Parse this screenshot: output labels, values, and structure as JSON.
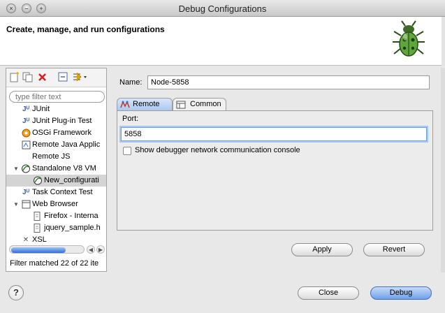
{
  "window": {
    "title": "Debug Configurations"
  },
  "header": {
    "heading": "Create, manage, and run configurations"
  },
  "left": {
    "filter_placeholder": "type filter text",
    "tree": [
      {
        "label": "JUnit",
        "icon": "junit-icon",
        "level": 1
      },
      {
        "label": "JUnit Plug-in Test",
        "icon": "junit-plugin-icon",
        "level": 1
      },
      {
        "label": "OSGi Framework",
        "icon": "osgi-icon",
        "level": 1
      },
      {
        "label": "Remote Java Applic",
        "icon": "remote-java-icon",
        "level": 1
      },
      {
        "label": "Remote JS",
        "icon": "remote-js-icon",
        "level": 1
      },
      {
        "label": "Standalone V8 VM",
        "icon": "v8-icon",
        "level": 1,
        "expanded": true
      },
      {
        "label": "New_configurati",
        "icon": "v8-config-icon",
        "level": 2,
        "selected": true
      },
      {
        "label": "Task Context Test",
        "icon": "task-context-icon",
        "level": 1
      },
      {
        "label": "Web Browser",
        "icon": "web-browser-icon",
        "level": 1,
        "expanded": true
      },
      {
        "label": "Firefox - Interna",
        "icon": "document-icon",
        "level": 2
      },
      {
        "label": "jquery_sample.h",
        "icon": "document-icon",
        "level": 2
      },
      {
        "label": "XSL",
        "icon": "xsl-icon",
        "level": 1
      }
    ],
    "status": "Filter matched 22 of 22 ite"
  },
  "right": {
    "name_label": "Name:",
    "name_value": "Node-5858",
    "tabs": [
      {
        "label": "Remote",
        "icon": "remote-icon",
        "active": true
      },
      {
        "label": "Common",
        "icon": "common-tab-icon",
        "active": false
      }
    ],
    "port_label": "Port:",
    "port_value": "5858",
    "checkbox_label": "Show debugger network communication console",
    "apply_label": "Apply",
    "revert_label": "Revert"
  },
  "footer": {
    "help_symbol": "?",
    "close_label": "Close",
    "debug_label": "Debug"
  },
  "colors": {
    "accent": "#2d6fd8",
    "selection": "#d4d4d4"
  }
}
